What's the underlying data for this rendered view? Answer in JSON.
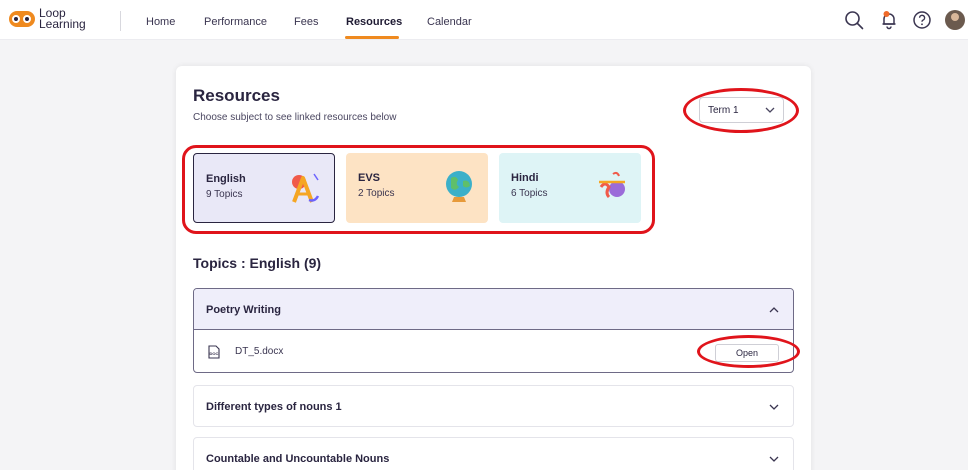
{
  "app": {
    "logo_line1": "Loop",
    "logo_line2": "Learning"
  },
  "nav": {
    "items": [
      {
        "label": "Home"
      },
      {
        "label": "Performance"
      },
      {
        "label": "Fees"
      },
      {
        "label": "Resources"
      },
      {
        "label": "Calendar"
      }
    ],
    "active": "Resources"
  },
  "header_icons": [
    "search-icon",
    "notification-bell-icon",
    "help-icon",
    "profile-avatar"
  ],
  "page": {
    "title": "Resources",
    "subtitle": "Choose subject to see linked resources below",
    "term_select": {
      "value": "Term 1"
    }
  },
  "subjects": [
    {
      "name": "English",
      "topics": "9 Topics",
      "color": "#e9e8f7",
      "icon": "english-letters-icon",
      "selected": true
    },
    {
      "name": "EVS",
      "topics": "2 Topics",
      "color": "#fde3c4",
      "icon": "globe-icon",
      "selected": false
    },
    {
      "name": "Hindi",
      "topics": "6 Topics",
      "color": "#def4f6",
      "icon": "hindi-script-icon",
      "selected": false
    }
  ],
  "topics_heading": "Topics : English (9)",
  "topics": [
    {
      "title": "Poetry Writing",
      "expanded": true,
      "files": [
        {
          "name": "DT_5.docx",
          "type_label": "DOC",
          "action": "Open"
        }
      ]
    },
    {
      "title": "Different types of nouns 1",
      "expanded": false
    },
    {
      "title": "Countable and Uncountable Nouns",
      "expanded": false
    }
  ],
  "colors": {
    "accent": "#ef8a1f",
    "annotation": "#e0141b",
    "expanded_header": "#efeefa"
  }
}
